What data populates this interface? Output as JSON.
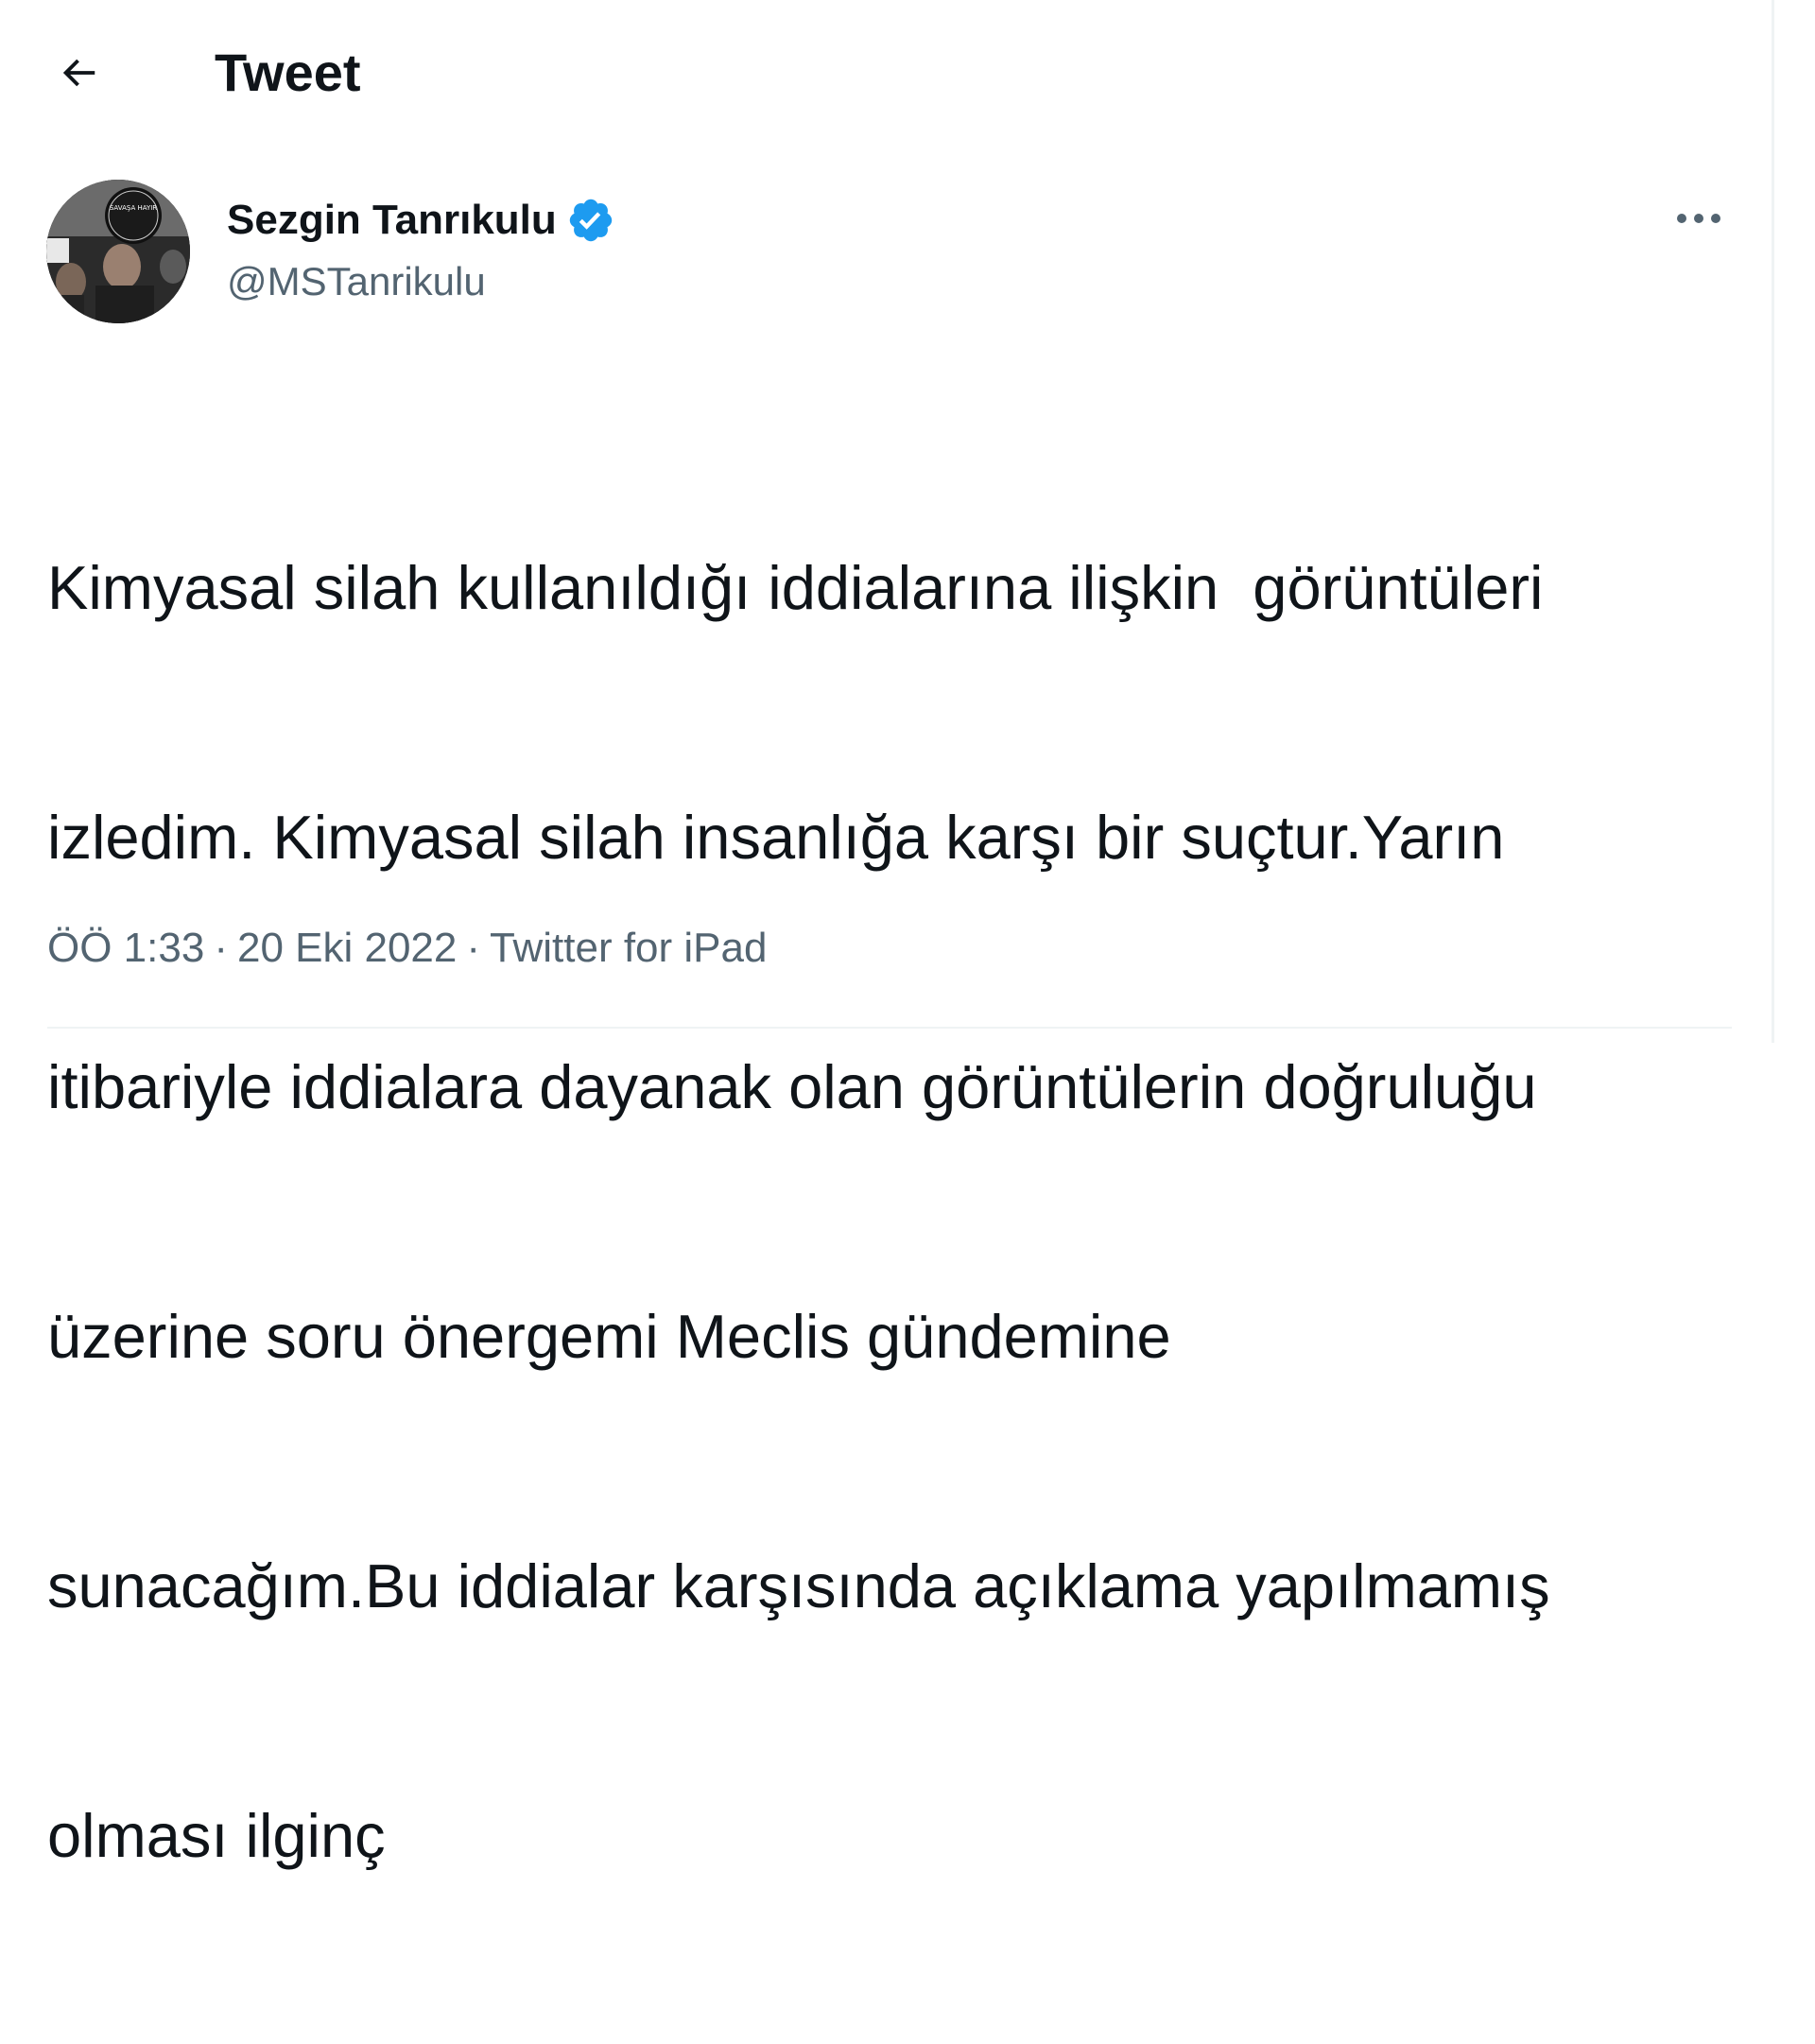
{
  "header": {
    "back_icon": "arrow-left-icon",
    "title": "Tweet"
  },
  "author": {
    "name": "Sezgin Tanrıkulu",
    "handle": "@MSTanrikulu",
    "verified_icon": "verified-badge-icon",
    "verified_color": "#1d9bf0",
    "avatar_sign_text": "SAVAŞA HAYIR"
  },
  "more_icon": "more-horizontal-icon",
  "tweet": {
    "lines": [
      "Kimyasal silah kullanıldığı iddialarına ilişkin  görüntüleri",
      "izledim. Kimyasal silah insanlığa karşı bir suçtur.Yarın",
      "itibariyle iddialara dayanak olan görüntülerin doğruluğu",
      "üzerine soru önergemi Meclis gündemine",
      "sunacağım.Bu iddialar karşısında açıklama yapılmamış",
      "olması ilginç"
    ]
  },
  "meta": {
    "time": "ÖÖ 1:33",
    "separator": "·",
    "date": "20 Eki 2022",
    "source": "Twitter for iPad"
  },
  "colors": {
    "text_primary": "#0f1419",
    "text_secondary": "#536471",
    "divider": "#eff3f4",
    "accent": "#1d9bf0"
  }
}
